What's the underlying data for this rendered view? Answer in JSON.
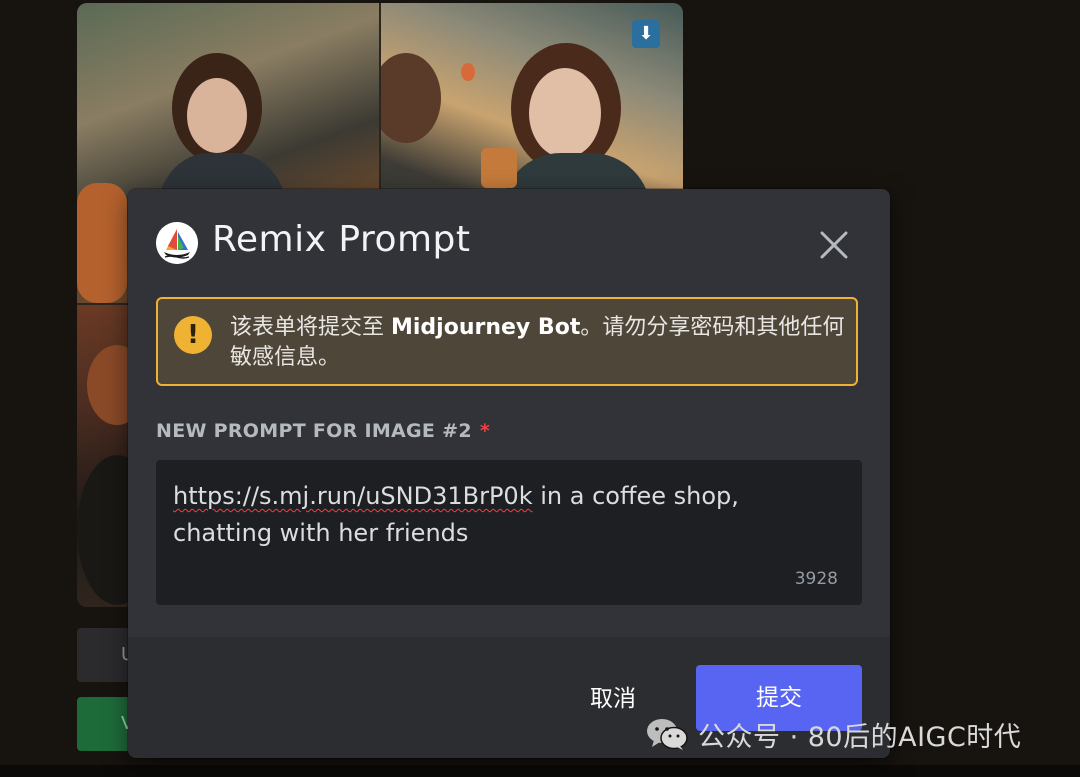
{
  "background": {
    "download_icon": "download-arrow-icon",
    "buttons": [
      "U",
      "V"
    ]
  },
  "modal": {
    "title": "Remix Prompt",
    "bot_avatar_icon": "midjourney-sailboat-icon",
    "close_icon": "close-icon",
    "warning": {
      "icon": "exclamation-icon",
      "text_before": "该表单将提交至 ",
      "bot_name": "Midjourney Bot",
      "text_after": "。请勿分享密码和其他任何敏感信息。"
    },
    "field": {
      "label": "NEW PROMPT FOR IMAGE #2",
      "required_mark": "*",
      "value_link": "https://s.mj.run/uSND31BrP0k",
      "value_rest": " in a coffee shop, chatting with her friends",
      "remaining_chars": "3928"
    },
    "footer": {
      "cancel_label": "取消",
      "submit_label": "提交"
    }
  },
  "watermark": {
    "icon": "wechat-icon",
    "text": "公众号 · 80后的AIGC时代"
  },
  "colors": {
    "modal_bg": "#313338",
    "footer_bg": "#2b2d31",
    "warning_border": "#f0b232",
    "submit_bg": "#5865f2",
    "required": "#f23f43"
  }
}
